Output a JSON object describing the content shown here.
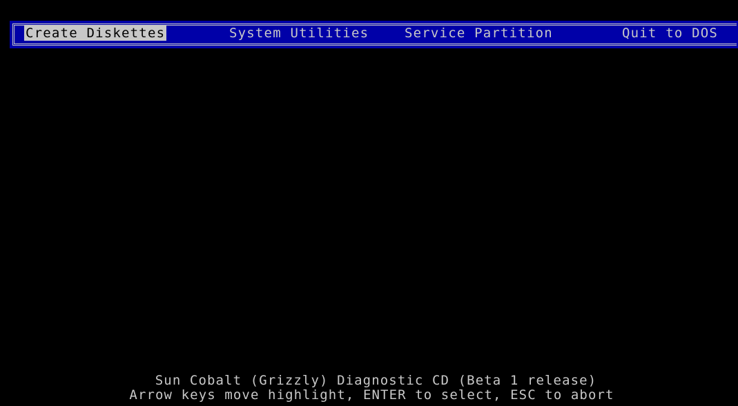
{
  "colors": {
    "background": "#000000",
    "menubar_bg": "#0000a8",
    "text": "#c8c8c8",
    "highlight_bg": "#c8c8c8",
    "highlight_text": "#000000"
  },
  "menu": {
    "items": [
      {
        "label": "Create Diskettes",
        "selected": true
      },
      {
        "label": "System Utilities",
        "selected": false
      },
      {
        "label": "Service Partition",
        "selected": false
      },
      {
        "label": "Quit to DOS",
        "selected": false
      }
    ]
  },
  "footer": {
    "title": "Sun Cobalt (Grizzly) Diagnostic CD (Beta 1 release)",
    "help": "Arrow keys move highlight, ENTER to select, ESC to abort"
  }
}
